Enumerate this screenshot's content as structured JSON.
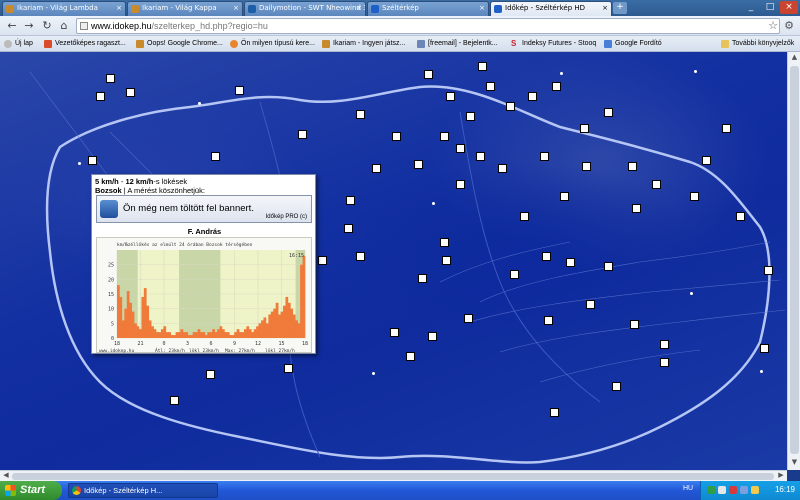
{
  "tabs": [
    {
      "label": "Ikariam - Világ Lambda",
      "active": false
    },
    {
      "label": "Ikariam - Világ Kappa",
      "active": false
    },
    {
      "label": "Dailymotion - SWT Nheowind 3",
      "active": false
    },
    {
      "label": "Széltérkép",
      "active": false
    },
    {
      "label": "Időkép - Széltérkép HD",
      "active": true
    }
  ],
  "address": {
    "host": "www.idokep.hu",
    "path": "/szelterkep_hd.php?regio=hu"
  },
  "bookmarks": [
    {
      "label": "Új lap",
      "icon_color": "#e3e3e3"
    },
    {
      "label": "Vezetőképes ragaszt...",
      "icon_color": "#d94b2b"
    },
    {
      "label": "Oops! Google Chrome...",
      "icon_color": "#c98a2b"
    },
    {
      "label": "Ön milyen típusú kere...",
      "icon_color": "#e8862e"
    },
    {
      "label": "Ikariam - Ingyen játsz...",
      "icon_color": "#c98a2b"
    },
    {
      "label": "[freemail] - Bejelentk...",
      "icon_color": "#6d86b8"
    },
    {
      "label": "Indeksy Futures - Stooq",
      "icon_color": "#c8202a"
    },
    {
      "label": "Google Fordító",
      "icon_color": "#4a7fd8"
    }
  ],
  "other_bookmarks": "További könyvjelzők",
  "popup": {
    "wind_speed": "5 km/h",
    "gust_text_mid": " - ",
    "gust_speed": "12 km/h",
    "gust_suffix": "-s lökések",
    "station": "Bozsok",
    "thanks": " | A mérést köszönhetjük:",
    "banner_text": "Ön még nem töltött fel bannert.",
    "banner_brand": "Időkép PRO",
    "banner_brand_suffix": "(c)",
    "observer": "F. András"
  },
  "chart_data": {
    "type": "area",
    "title": "Széllökés az elmúlt 24 órában Bozsok térségében",
    "ylabel": "km/h",
    "yticks": [
      0,
      5,
      10,
      15,
      20,
      25
    ],
    "ylim": [
      0,
      30
    ],
    "xticks": [
      "18",
      "21",
      "0",
      "3",
      "6",
      "9",
      "12",
      "15",
      "18"
    ],
    "last_value_label": "16:15",
    "footer": [
      "www.idokep.hu",
      "Átl: 23km/h",
      "lökl 23km/h",
      "Max: 27km/h",
      "lökl 27km/h"
    ],
    "series": [
      {
        "values": [
          18,
          14,
          6,
          10,
          16,
          12,
          9,
          5,
          4,
          3,
          14,
          17,
          11,
          6,
          4,
          3,
          2,
          2,
          3,
          4,
          2,
          2,
          1,
          1,
          2,
          2,
          3,
          2,
          2,
          1,
          1,
          2,
          2,
          3,
          2,
          2,
          1,
          2,
          2,
          3,
          2,
          3,
          4,
          3,
          2,
          2,
          1,
          1,
          2,
          3,
          2,
          2,
          3,
          4,
          3,
          2,
          3,
          4,
          5,
          6,
          7,
          5,
          8,
          9,
          10,
          12,
          8,
          9,
          11,
          14,
          12,
          10,
          8,
          6,
          5,
          25,
          28
        ]
      }
    ]
  },
  "taskbar": {
    "start": "Start",
    "item": "Időkép - Széltérkép H...",
    "lang": "HU",
    "clock": "16:19"
  },
  "colors": {
    "map_bg": "#1330a2",
    "border": "#a9bcf0",
    "chart_fill": "#f07a3a",
    "chart_bg": "#eef3c8"
  }
}
